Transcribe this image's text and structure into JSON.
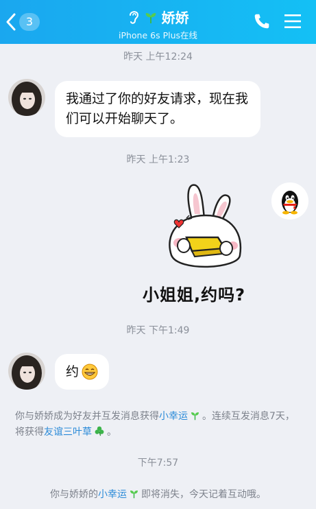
{
  "header": {
    "back_count": "3",
    "title": "娇娇",
    "subtitle": "iPhone 6s Plus在线"
  },
  "messages": {
    "time1": "昨天 上午12:24",
    "msg1": "我通过了你的好友请求，现在我们可以开始聊天了。",
    "time2": "昨天 上午1:23",
    "sticker_text": "小姐姐,约吗?",
    "time3": "昨天 下午1:49",
    "msg2": "约",
    "sys1_part1": "你与娇娇成为好友并互发消息获得",
    "sys1_link1": "小幸运",
    "sys1_part2": "。连续互发消息7天，将获得",
    "sys1_link2": "友谊三叶草",
    "sys1_part3": "。",
    "time4": "下午7:57",
    "sys2_part1": "你与娇娇的",
    "sys2_link": "小幸运",
    "sys2_part2": "即将消失，今天记着互动哦。"
  },
  "icons": {
    "back": "chevron-left-icon",
    "ear": "ear-icon",
    "sprout": "sprout-icon",
    "phone": "phone-icon",
    "menu": "menu-icon",
    "clover": "clover-icon",
    "grin_emoji": "grin-emoji-icon",
    "qq": "qq-penguin-icon"
  },
  "colors": {
    "header": "#14b4f3",
    "background": "#eef0f5",
    "link": "#2a8ad8"
  }
}
